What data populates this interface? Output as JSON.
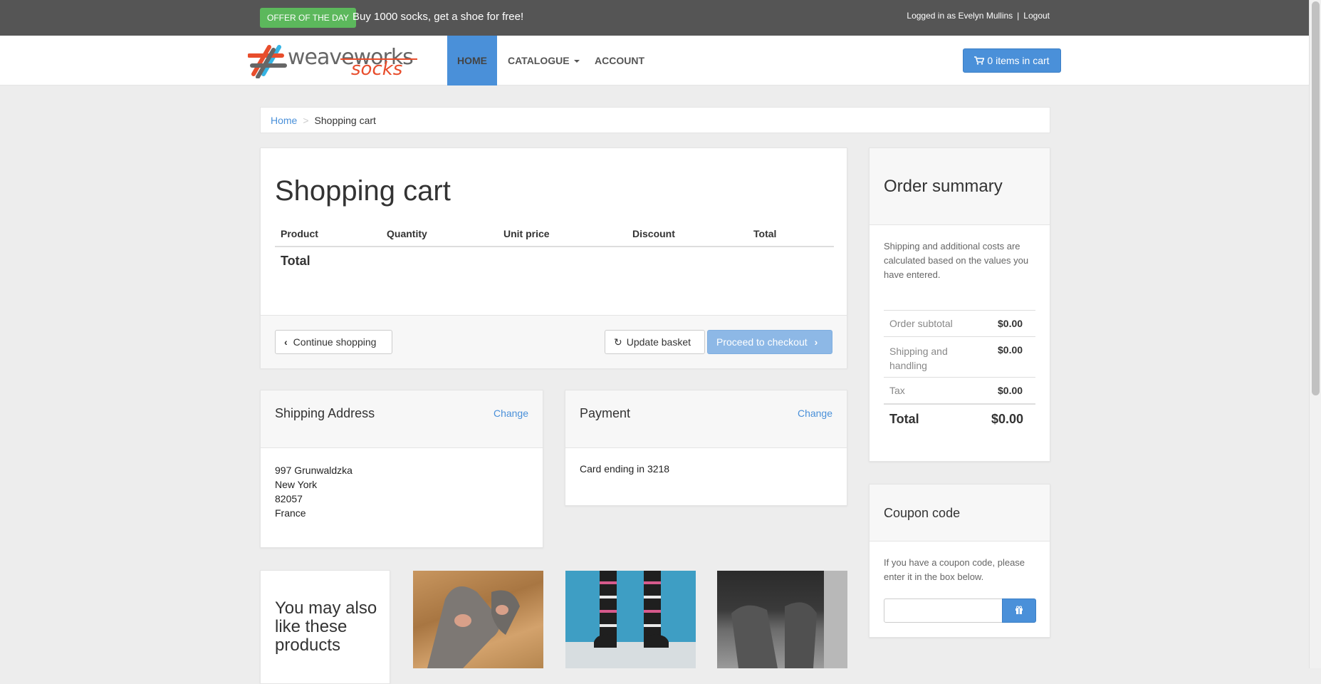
{
  "topbar": {
    "offer_badge": "OFFER OF THE DAY",
    "offer_text": "Buy 1000 socks, get a shoe for free!",
    "login_text": "Logged in as Evelyn Mullins",
    "separator": "|",
    "logout": "Logout"
  },
  "brand": {
    "word": "weaveworks",
    "sub": "socks"
  },
  "nav": {
    "home": "HOME",
    "catalogue": "CATALOGUE",
    "account": "ACCOUNT",
    "cart_button": "0 items in cart"
  },
  "breadcrumb": {
    "home": "Home",
    "current": "Shopping cart"
  },
  "cart": {
    "title": "Shopping cart",
    "columns": [
      "Product",
      "Quantity",
      "Unit price",
      "Discount",
      "Total"
    ],
    "total_label": "Total",
    "continue_label": "Continue shopping",
    "update_label": "Update basket",
    "checkout_label": "Proceed to checkout"
  },
  "shipping": {
    "title": "Shipping Address",
    "change": "Change",
    "lines": [
      "997 Grunwaldzka",
      "New York",
      "82057",
      "France"
    ]
  },
  "payment": {
    "title": "Payment",
    "change": "Change",
    "card": "Card ending in 3218"
  },
  "summary": {
    "title": "Order summary",
    "note": "Shipping and additional costs are calculated based on the values you have entered.",
    "rows": [
      {
        "label": "Order subtotal",
        "value": "$0.00"
      },
      {
        "label": "Shipping and handling",
        "value": "$0.00"
      },
      {
        "label": "Tax",
        "value": "$0.00"
      }
    ],
    "total_label": "Total",
    "total_value": "$0.00"
  },
  "coupon": {
    "title": "Coupon code",
    "note": "If you have a coupon code, please enter it in the box below.",
    "input_value": ""
  },
  "like": {
    "title": "You may also like these products"
  },
  "icons": {
    "cart": "shopping-cart-icon",
    "refresh": "refresh-icon",
    "chevron_left": "chevron-left-icon",
    "chevron_right": "chevron-right-icon",
    "gift": "gift-icon"
  },
  "colors": {
    "accent": "#4a90d9",
    "offer": "#5cb85c",
    "topbar": "#555555",
    "brand_socks": "#e84d2c"
  }
}
